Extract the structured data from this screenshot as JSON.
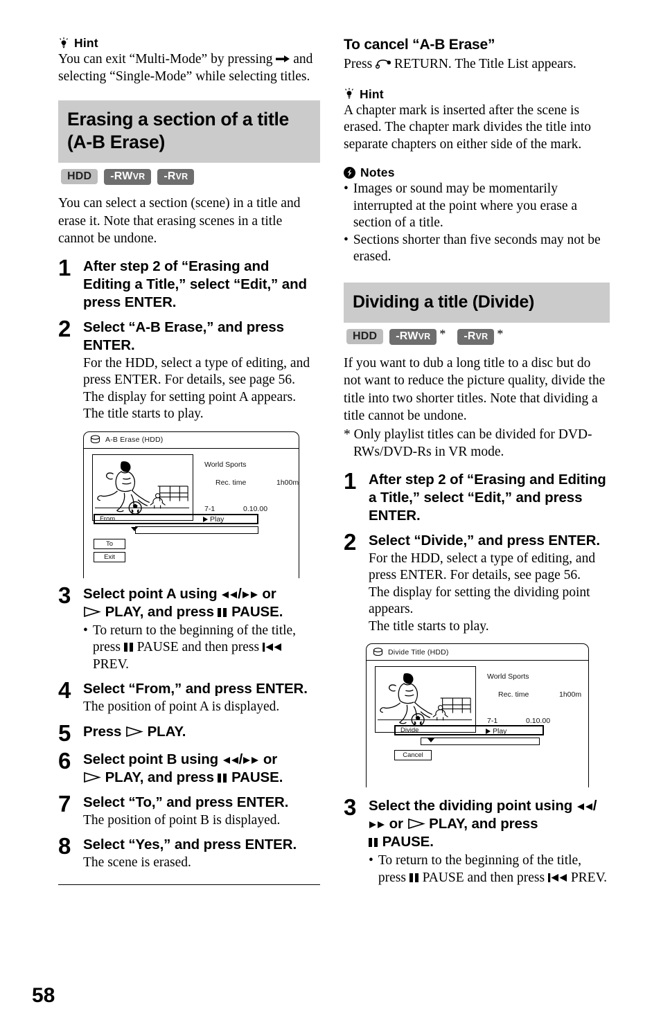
{
  "page": {
    "number": "58"
  },
  "left": {
    "hint": {
      "icon": "lightbulb-icon",
      "title": "Hint",
      "line1_a": "You can exit “Multi-Mode” by pressing",
      "line1_b": "and",
      "line2": "selecting “Single-Mode” while selecting titles."
    },
    "section": {
      "title_line1": "Erasing a section of a title",
      "title_line2": "(A-B Erase)",
      "badges": [
        {
          "label": "HDD",
          "style": "hdd",
          "star": ""
        },
        {
          "label": "-RW",
          "sub": "VR",
          "style": "dark",
          "star": ""
        },
        {
          "label": "-R",
          "sub": "VR",
          "style": "dark",
          "star": ""
        }
      ],
      "intro": "You can select a section (scene) in a title and erase it. Note that erasing scenes in a title cannot be undone."
    },
    "steps": [
      {
        "num": "1",
        "title": "After step 2 of “Erasing and Editing a Title,” select “Edit,” and press ENTER.",
        "desc": ""
      },
      {
        "num": "2",
        "title": "Select “A-B Erase,” and press ENTER.",
        "desc": "For the HDD, select a type of editing, and press ENTER. For details, see page 56.\nThe display for setting point A appears.\nThe title starts to play."
      },
      {
        "num": "3",
        "title_pre": "Select point A using",
        "title_mid": "or",
        "title_play": "PLAY, and press",
        "title_end": "PAUSE.",
        "bullet_pre": "To return to the beginning of the title, press",
        "bullet_mid": "PAUSE and then press",
        "bullet_end": "PREV."
      },
      {
        "num": "4",
        "title": "Select “From,” and press ENTER.",
        "desc": "The position of point A is displayed."
      },
      {
        "num": "5",
        "title_pre": "Press",
        "title_end": "PLAY."
      },
      {
        "num": "6",
        "title_pre": "Select point B using",
        "title_mid": "or",
        "title_play": "PLAY, and press",
        "title_end": "PAUSE."
      },
      {
        "num": "7",
        "title": "Select “To,” and press ENTER.",
        "desc": "The position of point B is displayed."
      },
      {
        "num": "8",
        "title": "Select “Yes,” and press ENTER.",
        "desc": "The scene is erased."
      }
    ],
    "osd": {
      "icon": "hdd-disc-icon",
      "title": "A-B Erase (HDD)",
      "thumb_alt": "soccer-player-illustration",
      "video_title": "World Sports",
      "rec_time_label": "Rec. time",
      "rec_time_value": "1h00m",
      "chapter": "7-1",
      "timecode": "0.10.00",
      "play_label": "Play",
      "selected_button": "From",
      "button_2": "To",
      "button_3": "Exit"
    }
  },
  "right": {
    "cancel": {
      "heading": "To cancel “A-B Erase”",
      "text_pre": "Press",
      "text_post": "RETURN. The Title List appears.",
      "return_icon": "return-arrow-icon"
    },
    "hint": {
      "icon": "lightbulb-icon",
      "title": "Hint",
      "text": "A chapter mark is inserted after the scene is erased. The chapter mark divides the title into separate chapters on either side of the mark."
    },
    "notes": {
      "icon": "notes-exclamation-icon",
      "title": "Notes",
      "items": [
        "Images or sound may be momentarily interrupted at the point where you erase a section of a title.",
        "Sections shorter than five seconds may not be erased."
      ]
    },
    "section": {
      "title": "Dividing a title (Divide)",
      "badges": [
        {
          "label": "HDD",
          "style": "hdd",
          "star": ""
        },
        {
          "label": "-RW",
          "sub": "VR",
          "style": "dark",
          "star": "*"
        },
        {
          "label": "-R",
          "sub": "VR",
          "style": "dark",
          "star": "*"
        }
      ],
      "intro": "If you want to dub a long title to a disc but do not want to reduce the picture quality, divide the title into two shorter titles. Note that dividing a title cannot be undone.",
      "footnote": "* Only playlist titles can be divided for DVD-RWs/DVD-Rs in VR mode."
    },
    "steps": [
      {
        "num": "1",
        "title": "After step 2 of “Erasing and Editing a Title,” select “Edit,” and press ENTER.",
        "desc": ""
      },
      {
        "num": "2",
        "title": "Select “Divide,” and press ENTER.",
        "desc": "For the HDD, select a type of editing, and press ENTER. For details, see page 56.\nThe display for setting the dividing point appears.\nThe title starts to play."
      },
      {
        "num": "3",
        "title_pre": "Select the dividing point using",
        "title_mid": "or",
        "title_play": "PLAY, and press",
        "title_end": "PAUSE.",
        "bullet_pre": "To return to the beginning of the title, press",
        "bullet_mid": "PAUSE and then press",
        "bullet_end": "PREV."
      }
    ],
    "osd": {
      "icon": "hdd-disc-icon",
      "title": "Divide Title (HDD)",
      "thumb_alt": "soccer-player-illustration",
      "video_title": "World Sports",
      "rec_time_label": "Rec. time",
      "rec_time_value": "1h00m",
      "chapter": "7-1",
      "timecode": "0.10.00",
      "play_label": "Play",
      "selected_button": "Divide",
      "button_2": "Cancel"
    }
  },
  "colors": {
    "banner_bg": "#cbcbcb",
    "badge_hdd_bg": "#bdbdbd",
    "badge_dark_bg": "#6e6e6e"
  }
}
